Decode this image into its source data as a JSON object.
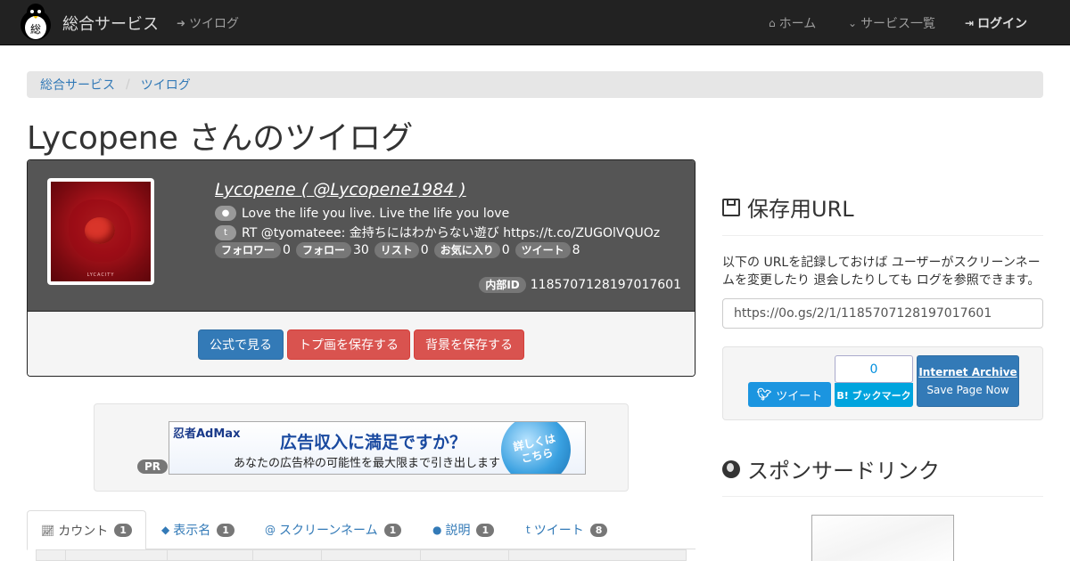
{
  "navbar": {
    "brand": "総合サービス",
    "logo_char": "総",
    "twilog_link": "ツイログ",
    "home": "ホーム",
    "services": "サービス一覧",
    "login": "ログイン"
  },
  "breadcrumb": {
    "items": [
      "総合サービス",
      "ツイログ"
    ],
    "separator": "/"
  },
  "page_title": "Lycopene さんのツイログ",
  "profile": {
    "name_line": "Lycopene ( @Lycopene1984 )",
    "bio": "Love the life you live. Live the life you love",
    "latest_tweet": "RT @tyomateee: 金持ちにはわからない遊び https://t.co/ZUGOlVQUOz",
    "avatar_caption": "LYCACITY",
    "stats": [
      {
        "label": "フォロワー",
        "value": "0"
      },
      {
        "label": "フォロー",
        "value": "30"
      },
      {
        "label": "リスト",
        "value": "0"
      },
      {
        "label": "お気に入り",
        "value": "0"
      },
      {
        "label": "ツイート",
        "value": "8"
      }
    ],
    "internal_id_label": "内部ID",
    "internal_id": "1185707128197017601",
    "buttons": {
      "official": "公式で見る",
      "save_icon": "トプ画を保存する",
      "save_bg": "背景を保存する"
    }
  },
  "ad": {
    "pr": "PR",
    "logo": "忍者AdMax",
    "headline": "広告収入に満足ですか？",
    "sub": "あなたの広告枠の可能性を最大限まで引き出します",
    "cta": "詳しくは\nこちら"
  },
  "tabs": [
    {
      "label": "カウント",
      "count": "1",
      "icon": "line-chart-icon"
    },
    {
      "label": "表示名",
      "count": "1",
      "icon": "tag-icon"
    },
    {
      "label": "スクリーンネーム",
      "count": "1",
      "icon": "at-icon"
    },
    {
      "label": "説明",
      "count": "1",
      "icon": "comment-icon"
    },
    {
      "label": "ツイート",
      "count": "8",
      "icon": "twitter-icon"
    }
  ],
  "sidebar": {
    "save_url_heading": "保存用URL",
    "save_desc": "以下の URLを記録しておけば ユーザーがスクリーンネームを変更したり 退会したりしても ログを参照できます。",
    "url": "https://0o.gs/2/1/1185707128197017601",
    "tweet_button": "ツイート",
    "hatena_count": "0",
    "hatena_button": "B! ブックマーク",
    "ia_title": "Internet Archive",
    "ia_action": "Save Page Now",
    "sponsor_heading": "スポンサードリンク"
  },
  "colors": {
    "navbar": "#222222",
    "primary": "#337ab7",
    "danger": "#d9534f",
    "profile_bg": "#555555",
    "badge": "#777777"
  }
}
